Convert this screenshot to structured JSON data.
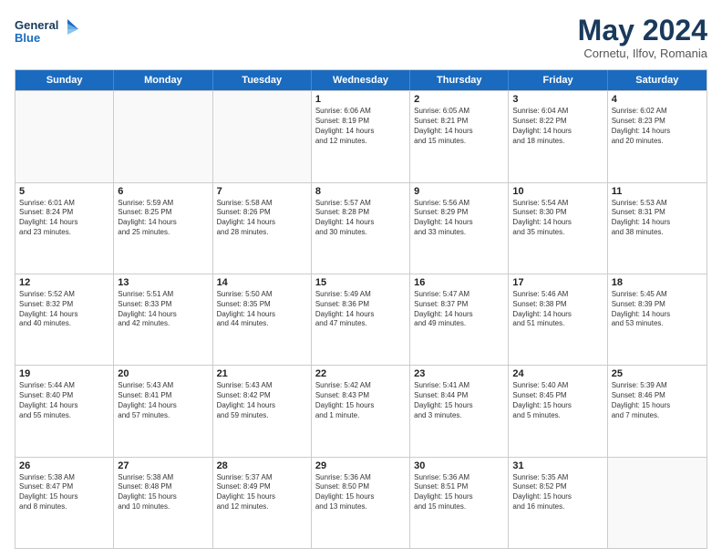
{
  "header": {
    "logo_line1": "General",
    "logo_line2": "Blue",
    "month_year": "May 2024",
    "location": "Cornetu, Ilfov, Romania"
  },
  "weekdays": [
    "Sunday",
    "Monday",
    "Tuesday",
    "Wednesday",
    "Thursday",
    "Friday",
    "Saturday"
  ],
  "rows": [
    [
      {
        "day": "",
        "text": "",
        "empty": true
      },
      {
        "day": "",
        "text": "",
        "empty": true
      },
      {
        "day": "",
        "text": "",
        "empty": true
      },
      {
        "day": "1",
        "text": "Sunrise: 6:06 AM\nSunset: 8:19 PM\nDaylight: 14 hours\nand 12 minutes."
      },
      {
        "day": "2",
        "text": "Sunrise: 6:05 AM\nSunset: 8:21 PM\nDaylight: 14 hours\nand 15 minutes."
      },
      {
        "day": "3",
        "text": "Sunrise: 6:04 AM\nSunset: 8:22 PM\nDaylight: 14 hours\nand 18 minutes."
      },
      {
        "day": "4",
        "text": "Sunrise: 6:02 AM\nSunset: 8:23 PM\nDaylight: 14 hours\nand 20 minutes."
      }
    ],
    [
      {
        "day": "5",
        "text": "Sunrise: 6:01 AM\nSunset: 8:24 PM\nDaylight: 14 hours\nand 23 minutes."
      },
      {
        "day": "6",
        "text": "Sunrise: 5:59 AM\nSunset: 8:25 PM\nDaylight: 14 hours\nand 25 minutes."
      },
      {
        "day": "7",
        "text": "Sunrise: 5:58 AM\nSunset: 8:26 PM\nDaylight: 14 hours\nand 28 minutes."
      },
      {
        "day": "8",
        "text": "Sunrise: 5:57 AM\nSunset: 8:28 PM\nDaylight: 14 hours\nand 30 minutes."
      },
      {
        "day": "9",
        "text": "Sunrise: 5:56 AM\nSunset: 8:29 PM\nDaylight: 14 hours\nand 33 minutes."
      },
      {
        "day": "10",
        "text": "Sunrise: 5:54 AM\nSunset: 8:30 PM\nDaylight: 14 hours\nand 35 minutes."
      },
      {
        "day": "11",
        "text": "Sunrise: 5:53 AM\nSunset: 8:31 PM\nDaylight: 14 hours\nand 38 minutes."
      }
    ],
    [
      {
        "day": "12",
        "text": "Sunrise: 5:52 AM\nSunset: 8:32 PM\nDaylight: 14 hours\nand 40 minutes."
      },
      {
        "day": "13",
        "text": "Sunrise: 5:51 AM\nSunset: 8:33 PM\nDaylight: 14 hours\nand 42 minutes."
      },
      {
        "day": "14",
        "text": "Sunrise: 5:50 AM\nSunset: 8:35 PM\nDaylight: 14 hours\nand 44 minutes."
      },
      {
        "day": "15",
        "text": "Sunrise: 5:49 AM\nSunset: 8:36 PM\nDaylight: 14 hours\nand 47 minutes."
      },
      {
        "day": "16",
        "text": "Sunrise: 5:47 AM\nSunset: 8:37 PM\nDaylight: 14 hours\nand 49 minutes."
      },
      {
        "day": "17",
        "text": "Sunrise: 5:46 AM\nSunset: 8:38 PM\nDaylight: 14 hours\nand 51 minutes."
      },
      {
        "day": "18",
        "text": "Sunrise: 5:45 AM\nSunset: 8:39 PM\nDaylight: 14 hours\nand 53 minutes."
      }
    ],
    [
      {
        "day": "19",
        "text": "Sunrise: 5:44 AM\nSunset: 8:40 PM\nDaylight: 14 hours\nand 55 minutes."
      },
      {
        "day": "20",
        "text": "Sunrise: 5:43 AM\nSunset: 8:41 PM\nDaylight: 14 hours\nand 57 minutes."
      },
      {
        "day": "21",
        "text": "Sunrise: 5:43 AM\nSunset: 8:42 PM\nDaylight: 14 hours\nand 59 minutes."
      },
      {
        "day": "22",
        "text": "Sunrise: 5:42 AM\nSunset: 8:43 PM\nDaylight: 15 hours\nand 1 minute."
      },
      {
        "day": "23",
        "text": "Sunrise: 5:41 AM\nSunset: 8:44 PM\nDaylight: 15 hours\nand 3 minutes."
      },
      {
        "day": "24",
        "text": "Sunrise: 5:40 AM\nSunset: 8:45 PM\nDaylight: 15 hours\nand 5 minutes."
      },
      {
        "day": "25",
        "text": "Sunrise: 5:39 AM\nSunset: 8:46 PM\nDaylight: 15 hours\nand 7 minutes."
      }
    ],
    [
      {
        "day": "26",
        "text": "Sunrise: 5:38 AM\nSunset: 8:47 PM\nDaylight: 15 hours\nand 8 minutes."
      },
      {
        "day": "27",
        "text": "Sunrise: 5:38 AM\nSunset: 8:48 PM\nDaylight: 15 hours\nand 10 minutes."
      },
      {
        "day": "28",
        "text": "Sunrise: 5:37 AM\nSunset: 8:49 PM\nDaylight: 15 hours\nand 12 minutes."
      },
      {
        "day": "29",
        "text": "Sunrise: 5:36 AM\nSunset: 8:50 PM\nDaylight: 15 hours\nand 13 minutes."
      },
      {
        "day": "30",
        "text": "Sunrise: 5:36 AM\nSunset: 8:51 PM\nDaylight: 15 hours\nand 15 minutes."
      },
      {
        "day": "31",
        "text": "Sunrise: 5:35 AM\nSunset: 8:52 PM\nDaylight: 15 hours\nand 16 minutes."
      },
      {
        "day": "",
        "text": "",
        "empty": true
      }
    ]
  ]
}
